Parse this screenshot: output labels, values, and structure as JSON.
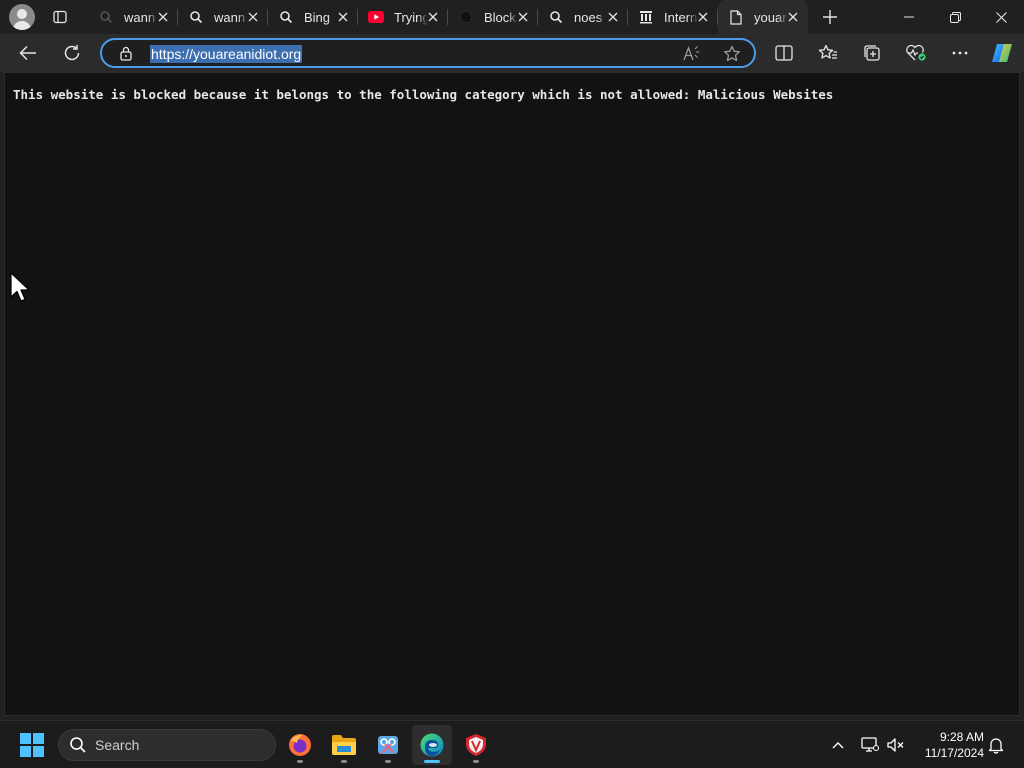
{
  "browser": {
    "tabs": [
      {
        "title": "wann",
        "favicon": "search-icon",
        "active": false
      },
      {
        "title": "wann",
        "favicon": "search-icon",
        "active": false
      },
      {
        "title": "Bing",
        "favicon": "search-icon",
        "active": false
      },
      {
        "title": "Trying",
        "favicon": "youtube-icon",
        "active": false
      },
      {
        "title": "Block",
        "favicon": "github-icon",
        "active": false
      },
      {
        "title": "noes",
        "favicon": "search-icon",
        "active": false
      },
      {
        "title": "Intern",
        "favicon": "internet-archive-icon",
        "active": false
      },
      {
        "title": "youar",
        "favicon": "page-icon",
        "active": true
      }
    ],
    "address": {
      "url": "https://youareanidiot.org"
    }
  },
  "page": {
    "message": "This website is blocked because it belongs to the following category which is not allowed: Malicious Websites"
  },
  "taskbar": {
    "search_label": "Search",
    "apps": [
      "firefox",
      "file-explorer",
      "snipping-tool",
      "edge",
      "app-shield"
    ],
    "active_app": "edge",
    "clock": {
      "time": "9:28 AM",
      "date": "11/17/2024"
    }
  },
  "colors": {
    "accent": "#4c9be8",
    "page_background": "#121212",
    "chrome_background": "#2b2b2b",
    "selection": "#3d6eb0"
  }
}
